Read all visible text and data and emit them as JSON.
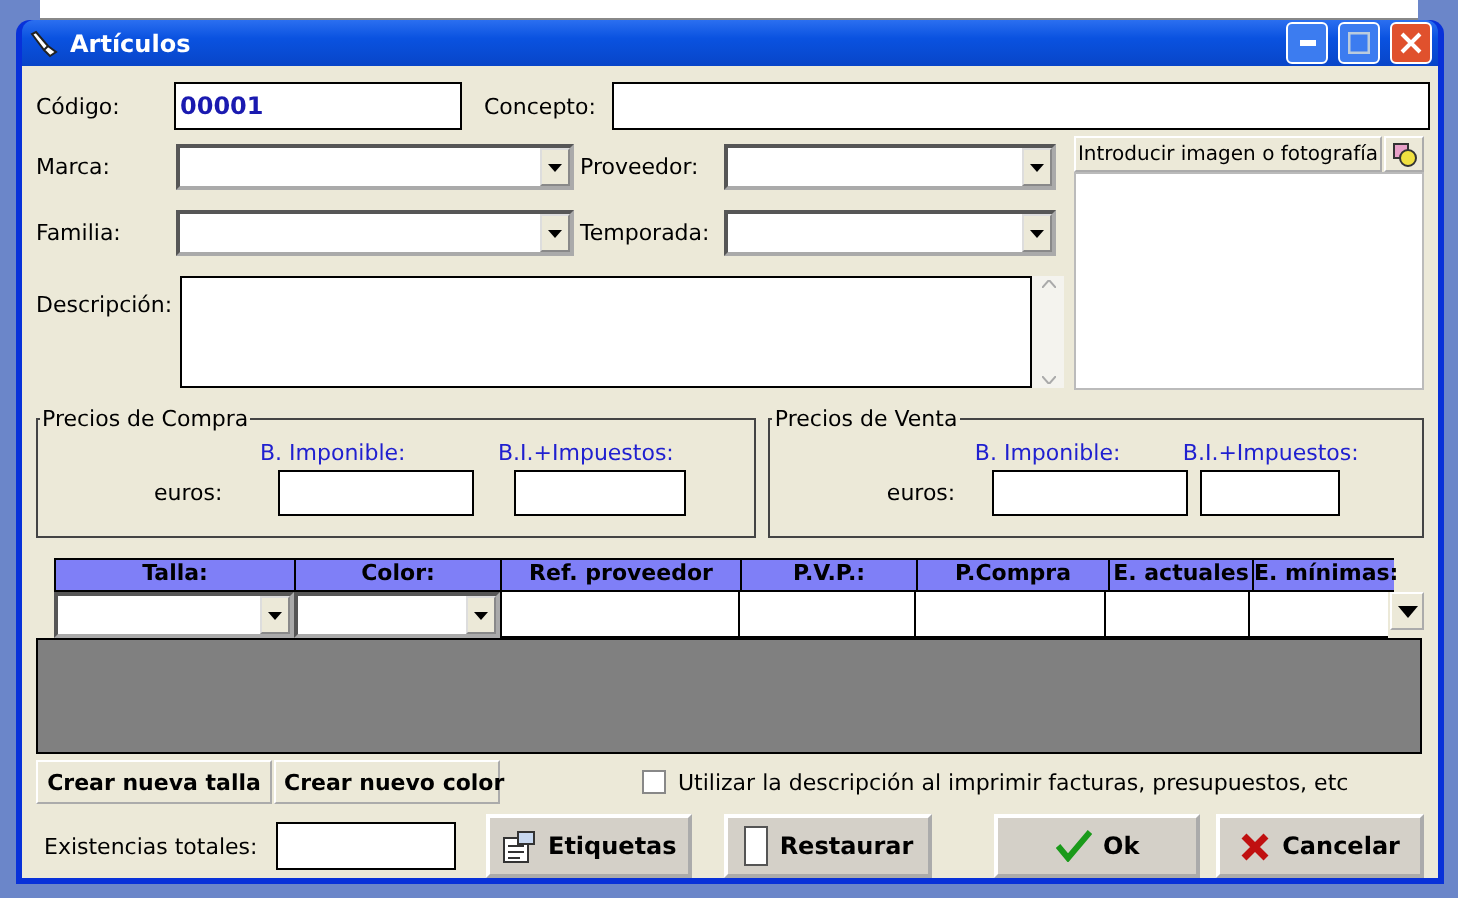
{
  "window": {
    "title": "Artículos"
  },
  "codigo": {
    "label": "Código:",
    "value": "00001"
  },
  "concepto": {
    "label": "Concepto:"
  },
  "combos": [
    {
      "label": "Marca:"
    },
    {
      "label": "Proveedor:"
    },
    {
      "label": "Familia:"
    },
    {
      "label": "Temporada:"
    }
  ],
  "descripcion": {
    "label": "Descripción:"
  },
  "image_panel": {
    "button": "Introducir imagen o fotografía"
  },
  "price_groups": [
    {
      "title": "Precios de Compra",
      "unit": "euros:",
      "columns": [
        "B. Imponible:",
        "B.I.+Impuestos:"
      ]
    },
    {
      "title": "Precios de Venta",
      "unit": "euros:",
      "columns": [
        "B. Imponible:",
        "B.I.+Impuestos:"
      ]
    }
  ],
  "grid": {
    "columns": [
      {
        "label": "Talla:",
        "kind": "combo"
      },
      {
        "label": "Color:",
        "kind": "combo"
      },
      {
        "label": "Ref. proveedor",
        "kind": "text"
      },
      {
        "label": "P.V.P.:",
        "kind": "text"
      },
      {
        "label": "P.Compra",
        "kind": "text"
      },
      {
        "label": "E. actuales",
        "kind": "text"
      },
      {
        "label": "E. mínimas:",
        "kind": "text"
      }
    ]
  },
  "create_buttons": [
    "Crear nueva talla",
    "Crear nuevo color"
  ],
  "checkbox": {
    "label": "Utilizar la descripción al imprimir facturas, presupuestos, etc",
    "checked": false
  },
  "existencias": {
    "label": "Existencias totales:"
  },
  "buttons": [
    {
      "label": "Etiquetas",
      "kind": "labels"
    },
    {
      "label": "Restaurar",
      "kind": "restore"
    },
    {
      "label": "Ok",
      "kind": "ok"
    },
    {
      "label": "Cancelar",
      "kind": "cancel"
    }
  ]
}
